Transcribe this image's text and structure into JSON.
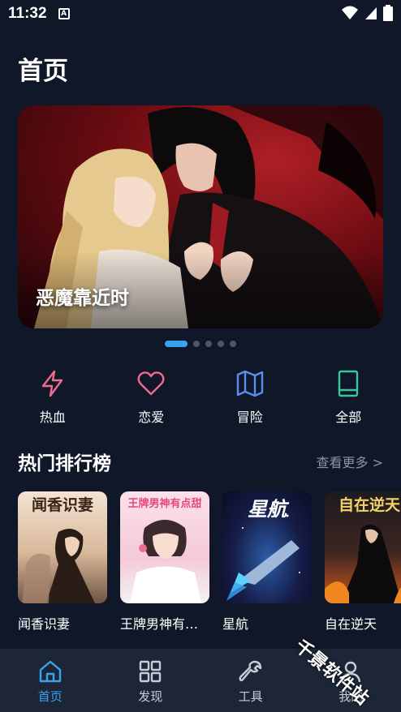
{
  "status": {
    "time": "11:32",
    "notif_letter": "A"
  },
  "header": {
    "title": "首页"
  },
  "banner": {
    "caption": "恶魔靠近时",
    "active_index": 0,
    "count": 5
  },
  "categories": [
    {
      "label": "热血",
      "icon": "lightning-icon",
      "color": "#f06b8e"
    },
    {
      "label": "恋爱",
      "icon": "heart-icon",
      "color": "#f06b8e"
    },
    {
      "label": "冒险",
      "icon": "map-icon",
      "color": "#5b8def"
    },
    {
      "label": "全部",
      "icon": "book-icon",
      "color": "#34c89a"
    }
  ],
  "ranking": {
    "title": "热门排行榜",
    "more": "查看更多 >",
    "books": [
      {
        "name": "闻香识妻",
        "cover_title": "闻香识妻"
      },
      {
        "name": "王牌男神有…",
        "cover_title": "王牌男神有点甜"
      },
      {
        "name": "星航",
        "cover_title": "星航"
      },
      {
        "name": "自在逆天",
        "cover_title": "自在逆天"
      }
    ]
  },
  "nav": [
    {
      "label": "首页",
      "icon": "home-icon",
      "active": true
    },
    {
      "label": "发现",
      "icon": "grid-icon",
      "active": false
    },
    {
      "label": "工具",
      "icon": "wrench-icon",
      "active": false
    },
    {
      "label": "我的",
      "icon": "user-icon",
      "active": false
    }
  ],
  "watermark": "千景软件站",
  "colors": {
    "accent": "#3aa3f0",
    "background": "#0f1729",
    "nav_bg": "#1c2637"
  }
}
